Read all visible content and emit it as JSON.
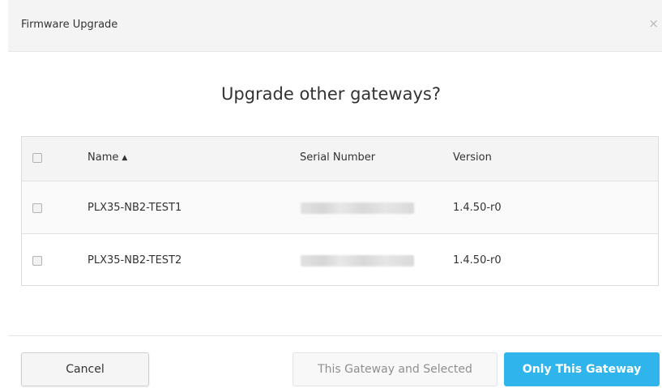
{
  "dialog": {
    "title": "Firmware Upgrade",
    "close_glyph": "×",
    "question": "Upgrade other gateways?"
  },
  "table": {
    "columns": {
      "name": "Name",
      "sort_indicator": "▲",
      "serial": "Serial Number",
      "version": "Version"
    },
    "rows": [
      {
        "name": "PLX35-NB2-TEST1",
        "version": "1.4.50-r0"
      },
      {
        "name": "PLX35-NB2-TEST2",
        "version": "1.4.50-r0"
      }
    ]
  },
  "footer": {
    "cancel_label": "Cancel",
    "selected_label": "This Gateway and Selected",
    "only_label": "Only This Gateway"
  },
  "colors": {
    "primary_button": "#2fb5ec",
    "header_bg": "#f4f4f4"
  }
}
